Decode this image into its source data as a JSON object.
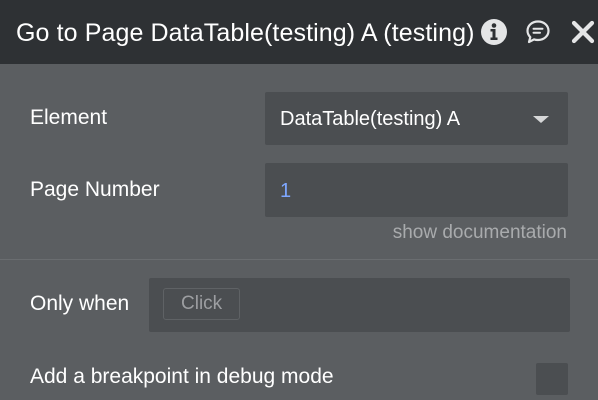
{
  "header": {
    "title": "Go to Page DataTable(testing) A (testing)",
    "icons": {
      "info": "info-icon",
      "comment": "comment-icon",
      "close": "close-icon"
    }
  },
  "fields": {
    "element": {
      "label": "Element",
      "value": "DataTable(testing) A"
    },
    "page_number": {
      "label": "Page Number",
      "value": "1"
    }
  },
  "show_documentation": "show documentation",
  "only_when": {
    "label": "Only when",
    "placeholder": "Click"
  },
  "breakpoint": {
    "label": "Add a breakpoint in debug mode",
    "checked": false
  },
  "colors": {
    "header_bg": "#2e3134",
    "panel_bg": "#5b5e61",
    "input_bg": "#4b4e51",
    "value_accent": "#7ea7ff"
  }
}
